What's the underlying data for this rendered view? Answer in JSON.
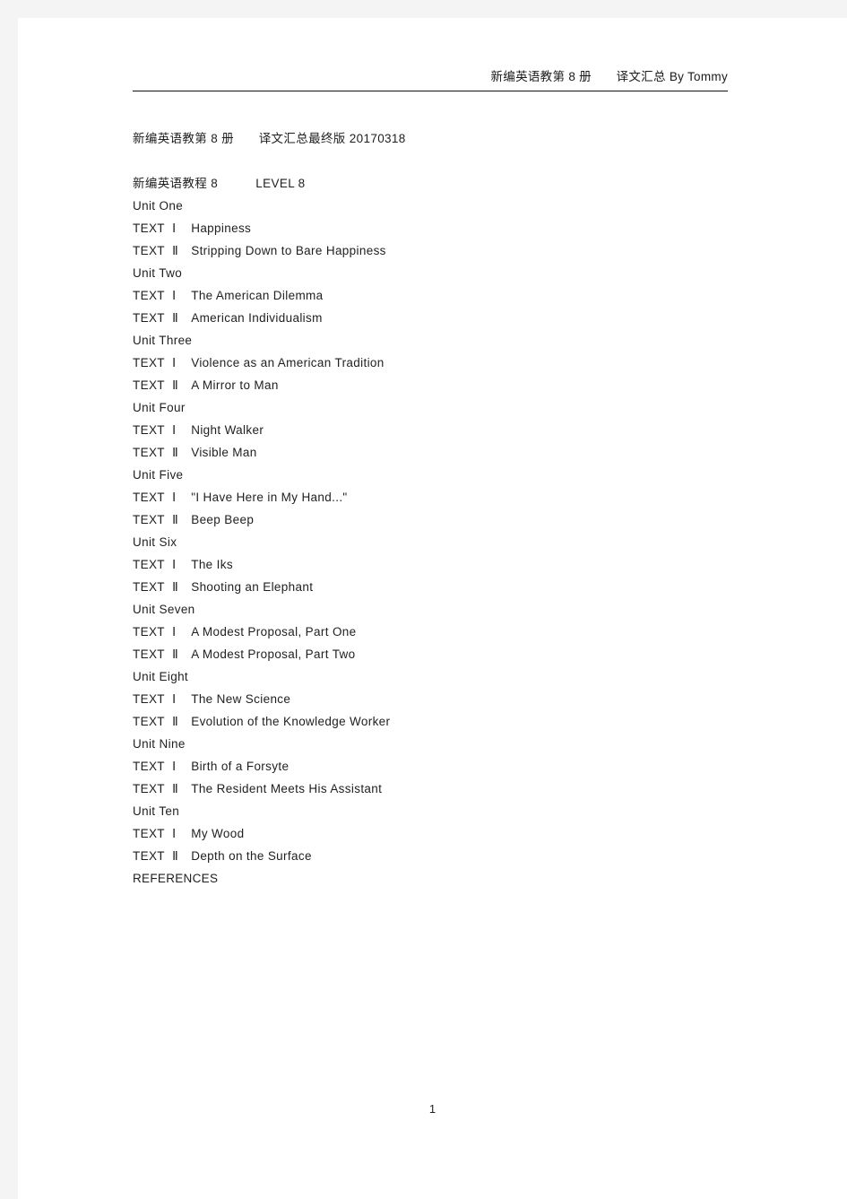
{
  "header": {
    "running_head": "新编英语教第 8 册　　译文汇总 By Tommy"
  },
  "document": {
    "doc_title": "新编英语教第 8 册　　译文汇总最终版 20170318",
    "subtitle_cn": "新编英语教程 8",
    "subtitle_en": "LEVEL 8",
    "references_label": "REFERENCES",
    "text_label": "TEXT",
    "numeral_one": "Ⅰ",
    "numeral_two": "Ⅱ",
    "units": [
      {
        "unit_label": "Unit One",
        "text_one_title": "Happiness",
        "text_two_title": "Stripping Down to Bare Happiness"
      },
      {
        "unit_label": "Unit Two",
        "text_one_title": "The American Dilemma",
        "text_two_title": "American Individualism"
      },
      {
        "unit_label": "Unit Three",
        "text_one_title": "Violence as an American Tradition",
        "text_two_title": "A Mirror to Man"
      },
      {
        "unit_label": "Unit Four",
        "text_one_title": "Night Walker",
        "text_two_title": "Visible Man"
      },
      {
        "unit_label": "Unit Five",
        "text_one_title": "\"I Have Here in My Hand...\"",
        "text_two_title": "Beep Beep"
      },
      {
        "unit_label": "Unit Six",
        "text_one_title": "The Iks",
        "text_two_title": "Shooting an Elephant"
      },
      {
        "unit_label": "Unit Seven",
        "text_one_title": "A Modest Proposal, Part One",
        "text_two_title": "A Modest Proposal, Part Two"
      },
      {
        "unit_label": "Unit Eight",
        "text_one_title": "The New Science",
        "text_two_title": "Evolution of the Knowledge Worker"
      },
      {
        "unit_label": "Unit Nine",
        "text_one_title": "Birth of a Forsyte",
        "text_two_title": "The Resident Meets His Assistant"
      },
      {
        "unit_label": "Unit Ten",
        "text_one_title": "My Wood",
        "text_two_title": "Depth on the Surface"
      }
    ]
  },
  "footer": {
    "page_number": "1"
  },
  "colors": {
    "text": "#1f1f1f",
    "rule": "#111111",
    "page_background": "#ffffff",
    "gutter": "#f4f4f4"
  }
}
